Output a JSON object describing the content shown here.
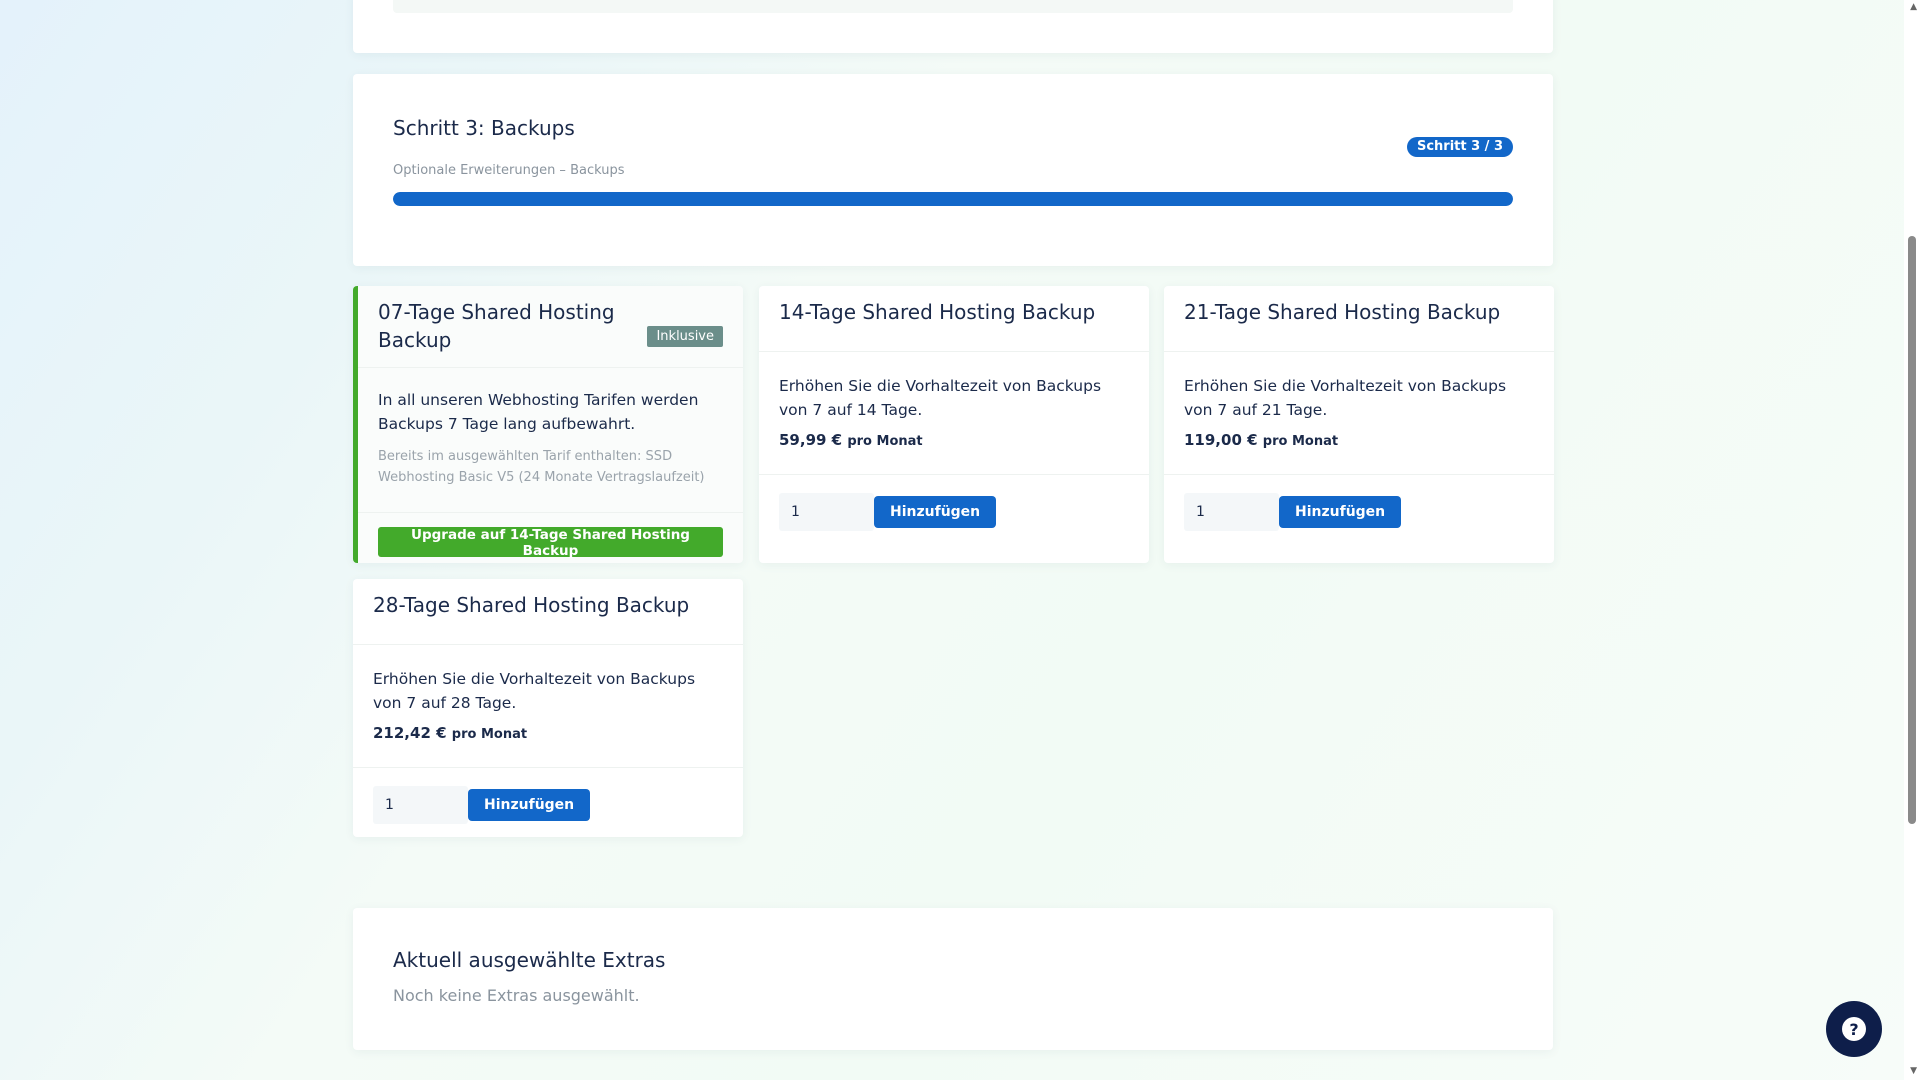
{
  "step": {
    "title": "Schritt 3: Backups",
    "badge": "Schritt 3 / 3",
    "subtitle": "Optionale Erweiterungen – Backups",
    "progress_percent": 100
  },
  "products": [
    {
      "title": "07-Tage Shared Hosting Backup",
      "badge": "Inklusive",
      "description": "In all unseren Webhosting Tarifen werden Backups 7 Tage lang aufbewahrt.",
      "included_note": "Bereits im ausgewählten Tarif enthalten: SSD Webhosting Basic V5 (24 Monate Vertragslaufzeit)",
      "upgrade_label": "Upgrade auf 14-Tage Shared Hosting Backup"
    },
    {
      "title": "14-Tage Shared Hosting Backup",
      "description": "Erhöhen Sie die Vorhaltezeit von Backups von 7 auf 14 Tage.",
      "price": "59,99 €",
      "period": "pro Monat",
      "quantity": "1",
      "add_label": "Hinzufügen"
    },
    {
      "title": "21-Tage Shared Hosting Backup",
      "description": "Erhöhen Sie die Vorhaltezeit von Backups von 7 auf 21 Tage.",
      "price": "119,00 €",
      "period": "pro Monat",
      "quantity": "1",
      "add_label": "Hinzufügen"
    },
    {
      "title": "28-Tage Shared Hosting Backup",
      "description": "Erhöhen Sie die Vorhaltezeit von Backups von 7 auf 28 Tage.",
      "price": "212,42 €",
      "period": "pro Monat",
      "quantity": "1",
      "add_label": "Hinzufügen"
    }
  ],
  "extras": {
    "title": "Aktuell ausgewählte Extras",
    "empty_text": "Noch keine Extras ausgewählt."
  },
  "help": {
    "icon": "question-icon",
    "glyph": "?"
  },
  "colors": {
    "primary": "#1267c9",
    "success": "#43aa2b",
    "badge_gray": "#6b8e8a",
    "help_bg": "#0e1e4a"
  }
}
